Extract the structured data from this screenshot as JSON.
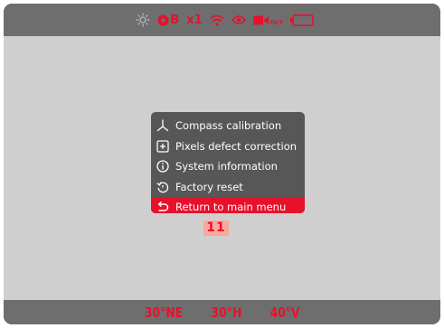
{
  "status_bar": {
    "icons": [
      "brightness-icon",
      "record-mode-icon",
      "wifi-icon",
      "eye-icon",
      "video-out-icon",
      "battery-icon"
    ],
    "mode_label": "B",
    "zoom_label": "x1",
    "video_out_label": "OUT",
    "accent_color": "#e8102b"
  },
  "menu": {
    "items": [
      {
        "label": "Compass calibration",
        "icon": "compass-icon",
        "selected": false
      },
      {
        "label": "Pixels defect correction",
        "icon": "plus-square-icon",
        "selected": false
      },
      {
        "label": "System information",
        "icon": "info-icon",
        "selected": false
      },
      {
        "label": "Factory reset",
        "icon": "reset-icon",
        "selected": false
      },
      {
        "label": "Return to main menu",
        "icon": "return-icon",
        "selected": true
      }
    ]
  },
  "step_badge": "11",
  "bottom_bar": {
    "heading": "30°NE",
    "height": "30°H",
    "vertical": "40°V"
  }
}
